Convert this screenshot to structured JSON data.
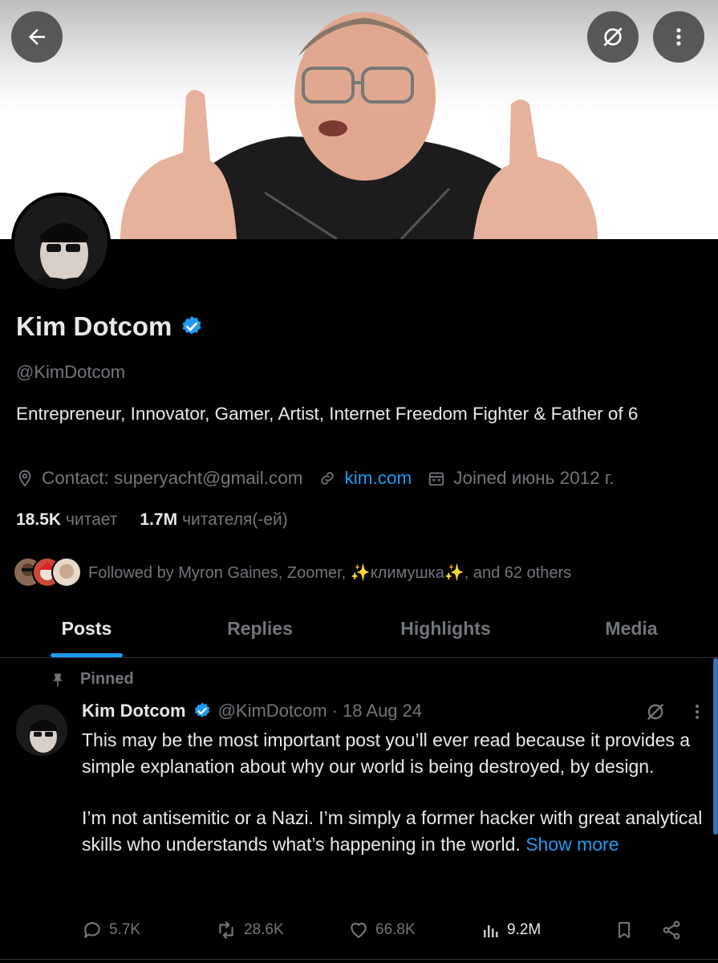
{
  "profile": {
    "name": "Kim Dotcom",
    "handle": "@KimDotcom",
    "bio": "Entrepreneur, Innovator, Gamer, Artist, Internet Freedom Fighter & Father of 6",
    "contact": "Contact: superyacht@gmail.com",
    "website": "kim.com",
    "joined": "Joined июнь 2012 г.",
    "following_count": "18.5K",
    "following_label": "читает",
    "followers_count": "1.7M",
    "followers_label": "читателя(-ей)",
    "followed_by": "Followed by Myron Gaines, Zoomer, ✨климушка✨, and 62 others"
  },
  "icons": {
    "back": "arrow-left-icon",
    "grok": "grok-slash-icon",
    "more": "more-vertical-icon",
    "verified": "verified-badge-icon",
    "location": "location-pin-icon",
    "link": "link-icon",
    "calendar": "calendar-icon",
    "pin": "pin-icon",
    "reply": "reply-icon",
    "repost": "repost-icon",
    "like": "heart-icon",
    "views": "views-bar-icon",
    "bookmark": "bookmark-icon",
    "share": "share-icon"
  },
  "tabs": [
    {
      "label": "Posts",
      "active": true
    },
    {
      "label": "Replies",
      "active": false
    },
    {
      "label": "Highlights",
      "active": false
    },
    {
      "label": "Media",
      "active": false
    }
  ],
  "post": {
    "pinned_label": "Pinned",
    "author": "Kim Dotcom",
    "handle": "@KimDotcom",
    "date": "· 18 Aug 24",
    "paragraph1": "This may be the most important post you’ll ever read because it provides a simple explanation about why our world is being destroyed, by design.",
    "paragraph2": "I’m not antisemitic or a Nazi. I’m simply a former hacker with great analytical skills who understands what’s happening in the world.",
    "show_more": "Show more",
    "replies": "5.7K",
    "reposts": "28.6K",
    "likes": "66.8K",
    "views": "9.2M"
  },
  "colors": {
    "background": "#000000",
    "text_primary": "#e7e9ea",
    "text_secondary": "#71767b",
    "accent": "#1d9bf0"
  }
}
